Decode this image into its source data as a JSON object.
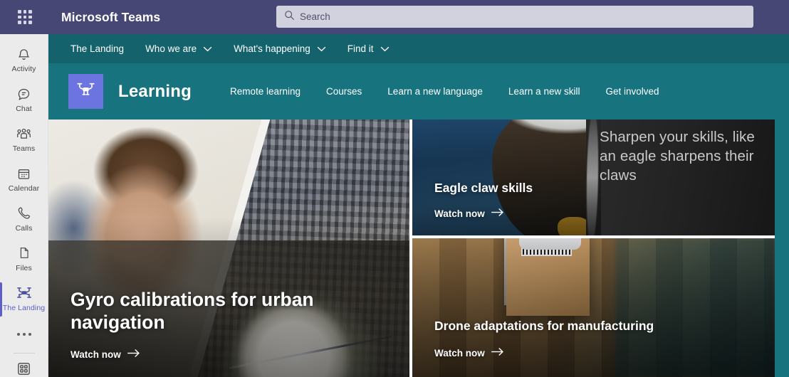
{
  "titlebar": {
    "app_name": "Microsoft Teams",
    "waffle_icon": "app-launcher-grid-icon",
    "search": {
      "placeholder": "Search",
      "value": "",
      "icon": "search-icon"
    }
  },
  "rail": {
    "items": [
      {
        "label": "Activity",
        "icon": "bell-icon",
        "active": false
      },
      {
        "label": "Chat",
        "icon": "chat-bubble-icon",
        "active": false
      },
      {
        "label": "Teams",
        "icon": "people-icon",
        "active": false
      },
      {
        "label": "Calendar",
        "icon": "calendar-icon",
        "active": false
      },
      {
        "label": "Calls",
        "icon": "phone-icon",
        "active": false
      },
      {
        "label": "Files",
        "icon": "file-icon",
        "active": false
      },
      {
        "label": "The Landing",
        "icon": "drone-icon",
        "active": true
      }
    ],
    "more_icon": "ellipsis-icon",
    "apps_icon": "apps-grid-icon"
  },
  "topnav": {
    "items": [
      {
        "label": "The Landing",
        "has_chevron": false
      },
      {
        "label": "Who we are",
        "has_chevron": true
      },
      {
        "label": "What's happening",
        "has_chevron": true
      },
      {
        "label": "Find it",
        "has_chevron": true
      }
    ]
  },
  "brandbar": {
    "site_logo_icon": "drone-icon",
    "site_name": "Learning",
    "links": [
      "Remote learning",
      "Courses",
      "Learn a new language",
      "Learn a new skill",
      "Get involved"
    ]
  },
  "cards": {
    "main": {
      "title": "Gyro calibrations for urban navigation",
      "cta": "Watch now",
      "cta_icon": "arrow-right-icon"
    },
    "eagle": {
      "title": "Eagle claw skills",
      "cta": "Watch now",
      "cta_icon": "arrow-right-icon",
      "caption": "Sharpen your skills, like an eagle sharpens their claws"
    },
    "drone": {
      "title": "Drone adaptations for manufacturing",
      "cta": "Watch now",
      "cta_icon": "arrow-right-icon"
    }
  },
  "colors": {
    "titlebar_purple": "#464775",
    "topnav_teal": "#14626b",
    "brandbar_teal": "#17737e",
    "rail_bg": "#ebebeb",
    "accent_purple": "#5b5fc7",
    "logo_tile": "#6c74e0"
  }
}
